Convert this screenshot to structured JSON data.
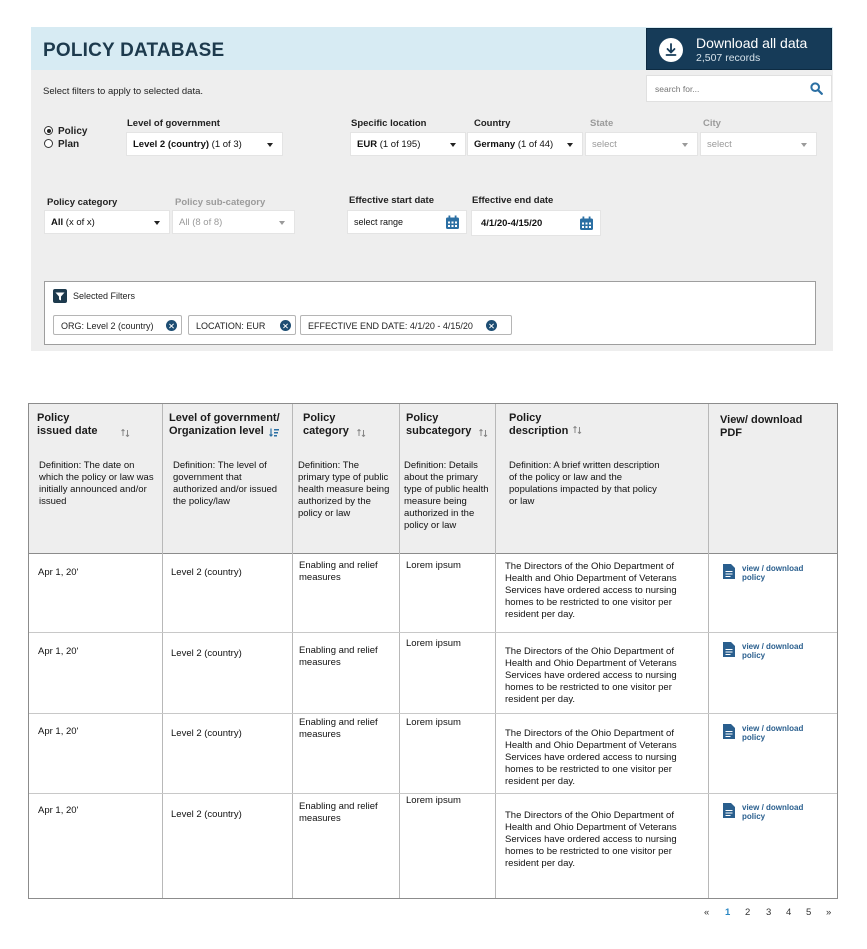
{
  "header": {
    "title": "POLICY DATABASE",
    "download_label": "Download all data",
    "download_count": "2,507 records",
    "search_placeholder": "search for...",
    "hint": "Select filters to apply to selected data."
  },
  "filters": {
    "type_options": [
      "Policy",
      "Plan"
    ],
    "type_selected": "Policy",
    "level": {
      "label": "Level of government",
      "value": "Level 2 (country)",
      "note": "(1 of 3)"
    },
    "location": {
      "label": "Specific location",
      "value": "EUR",
      "note": "(1 of 195)"
    },
    "country": {
      "label": "Country",
      "value": "Germany",
      "note": "(1 of 44)"
    },
    "state": {
      "label": "State",
      "value": "select"
    },
    "city": {
      "label": "City",
      "value": "select"
    },
    "category": {
      "label": "Policy category",
      "value": "All",
      "note": "(x of x)"
    },
    "subcategory": {
      "label": "Policy sub-category",
      "value": "All",
      "note": "(8 of 8)"
    },
    "start_date": {
      "label": "Effective start date",
      "value": "select range"
    },
    "end_date": {
      "label": "Effective end date",
      "value": "4/1/20-4/15/20"
    }
  },
  "selected_filters": {
    "label": "Selected Filters",
    "chips": [
      "ORG: Level 2 (country)",
      "LOCATION: EUR",
      "EFFECTIVE END DATE: 4/1/20 - 4/15/20"
    ]
  },
  "table": {
    "columns": [
      {
        "header": "Policy\nissued date",
        "definition": "Definition: The date on which the policy or law was initially announced and/or issued"
      },
      {
        "header": "Level of government/\nOrganization level",
        "definition": "Definition: The level of government that authorized and/or issued the policy/law"
      },
      {
        "header": "Policy\ncategory",
        "definition": "Definition: The primary type of public health measure being authorized by the policy or law"
      },
      {
        "header": "Policy\nsubcategory",
        "definition": "Definition: Details about the primary type of public health measure being authorized in the policy or law"
      },
      {
        "header": "Policy\ndescription",
        "definition": "Definition: A brief written description of the policy or law and the populations impacted by that policy or law"
      },
      {
        "header": "View/ download\nPDF",
        "definition": ""
      }
    ],
    "rows": [
      {
        "date": "Apr 1, 20'",
        "level": "Level 2 (country)",
        "category": "Enabling and relief measures",
        "subcategory": "Lorem ipsum",
        "description": "The Directors of the Ohio Department of Health and Ohio Department of Veterans Services have ordered access to nursing homes to be restricted to one visitor per resident per day.",
        "link": "view / download policy"
      },
      {
        "date": "Apr 1, 20'",
        "level": "Level 2 (country)",
        "category": "Enabling and relief measures",
        "subcategory": "Lorem ipsum",
        "description": "The Directors of the Ohio Department of Health and Ohio Department of Veterans Services have ordered access to nursing homes to be restricted to one visitor per resident per day.",
        "link": "view / download policy"
      },
      {
        "date": "Apr 1, 20'",
        "level": "Level 2 (country)",
        "category": "Enabling and relief measures",
        "subcategory": "Lorem ipsum",
        "description": "The Directors of the Ohio Department of Health and Ohio Department of Veterans Services have ordered access to nursing homes to be restricted to one visitor per resident per day.",
        "link": "view / download policy"
      },
      {
        "date": "Apr 1, 20'",
        "level": "Level 2 (country)",
        "category": "Enabling and relief measures",
        "subcategory": "Lorem ipsum",
        "description": "The Directors of the Ohio Department of Health and Ohio Department of Veterans Services have ordered access to nursing homes to be restricted to one visitor per resident per day.",
        "link": "view / download policy"
      }
    ]
  },
  "pagination": {
    "prev": "«",
    "pages": [
      "1",
      "2",
      "3",
      "4",
      "5"
    ],
    "current": "1",
    "next": "»"
  },
  "colors": {
    "header_band": "#d7ebf3",
    "primary": "#163b58",
    "panel": "#eeeeee",
    "link": "#2a5f8e",
    "active_page": "#2b88c4"
  }
}
